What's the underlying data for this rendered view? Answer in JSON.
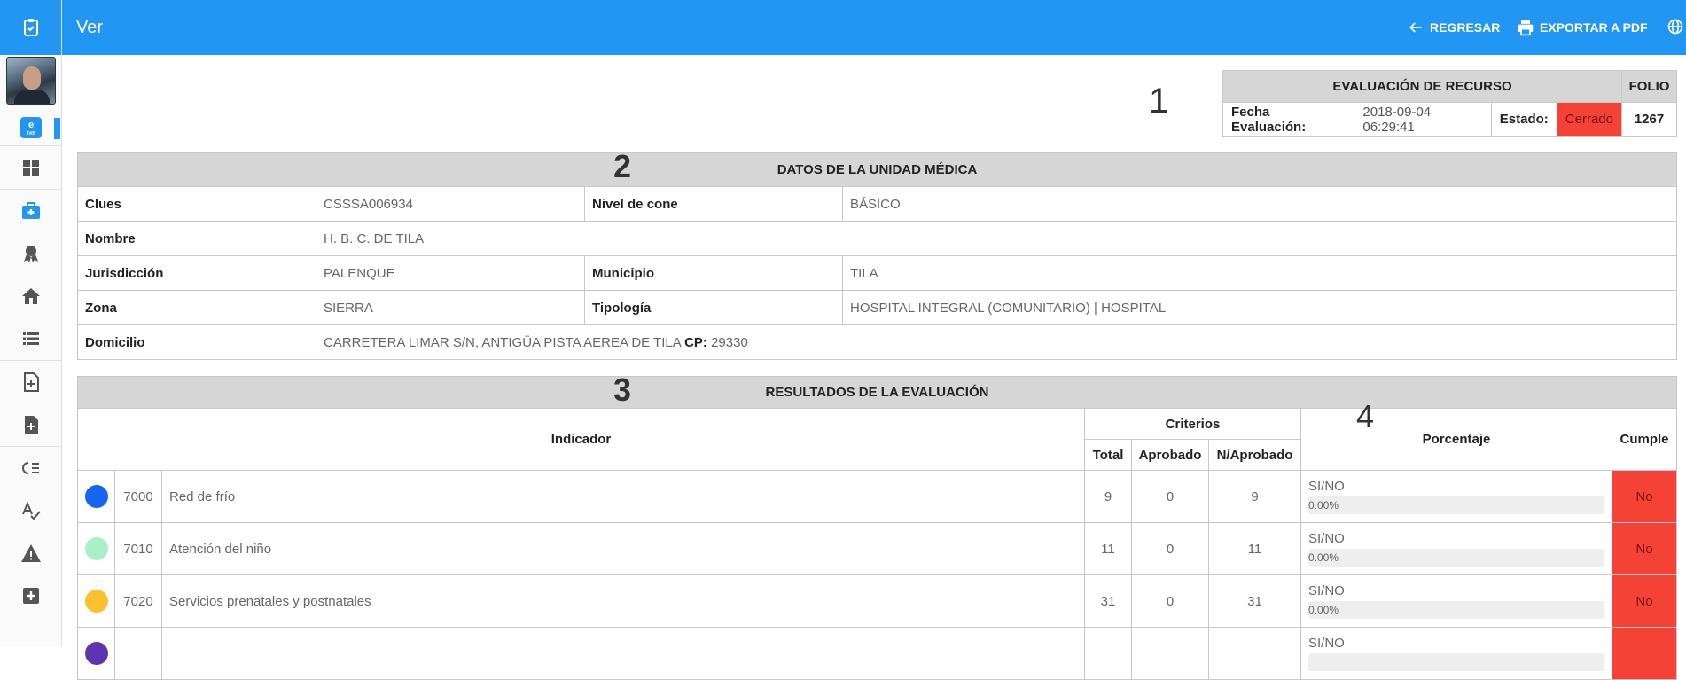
{
  "app": {
    "logo_icon": "clipboard-icon",
    "accent": "#2196f3"
  },
  "topbar": {
    "title": "Ver",
    "back_label": "REGRESAR",
    "export_label": "EXPORTAR A PDF"
  },
  "sidebar": {
    "items": [
      {
        "name": "dashboard-icon"
      },
      {
        "name": "medical-kit-icon"
      },
      {
        "name": "award-icon"
      },
      {
        "name": "house-icon"
      },
      {
        "name": "list-icon"
      },
      {
        "name": "add-document-icon"
      },
      {
        "name": "add-file-icon"
      },
      {
        "name": "checklist-icon"
      },
      {
        "name": "spellcheck-icon"
      },
      {
        "name": "warning-icon"
      },
      {
        "name": "plus-box-icon"
      }
    ],
    "etab": "e"
  },
  "markers": {
    "m1": "1",
    "m2": "2",
    "m3": "3",
    "m4": "4"
  },
  "evaluation": {
    "header": "EVALUACIÓN DE RECURSO",
    "folio_header": "FOLIO",
    "fecha_label": "Fecha Evaluación:",
    "fecha_value": "2018-09-04 06:29:41",
    "estado_label": "Estado:",
    "estado_value": "Cerrado",
    "folio_value": "1267"
  },
  "unit": {
    "header": "DATOS DE LA UNIDAD MÉDICA",
    "clues_label": "Clues",
    "clues_value": "CSSSA006934",
    "nivel_label": "Nivel de cone",
    "nivel_value": "BÁSICO",
    "nombre_label": "Nombre",
    "nombre_value": "H. B. C. DE TILA",
    "jurisdiccion_label": "Jurisdicción",
    "jurisdiccion_value": "PALENQUE",
    "municipio_label": "Municipio",
    "municipio_value": "TILA",
    "zona_label": "Zona",
    "zona_value": "SIERRA",
    "tipologia_label": "Tipología",
    "tipologia_value": "HOSPITAL INTEGRAL (COMUNITARIO) | HOSPITAL",
    "domicilio_label": "Domicilio",
    "domicilio_value": "CARRETERA LIMAR S/N, ANTIGÜA PISTA AEREA DE TILA",
    "cp_label": "CP:",
    "cp_value": "29330"
  },
  "results": {
    "header": "RESULTADOS DE LA EVALUACIÓN",
    "col_indicador": "Indicador",
    "col_criterios": "Criterios",
    "col_total": "Total",
    "col_aprobado": "Aprobado",
    "col_naprobado": "N/Aprobado",
    "col_porcentaje": "Porcentaje",
    "col_cumple": "Cumple",
    "rows": [
      {
        "color": "#1565f0",
        "code": "7000",
        "name": "Red de frío",
        "total": "9",
        "aprobado": "0",
        "naprobado": "9",
        "sino": "SI/NO",
        "pct": "0.00%",
        "pct_value": 0,
        "cumple": "No"
      },
      {
        "color": "#a8f0c8",
        "code": "7010",
        "name": "Atención del niño",
        "total": "11",
        "aprobado": "0",
        "naprobado": "11",
        "sino": "SI/NO",
        "pct": "0.00%",
        "pct_value": 0,
        "cumple": "No"
      },
      {
        "color": "#fbc02d",
        "code": "7020",
        "name": "Servicios prenatales y postnatales",
        "total": "31",
        "aprobado": "0",
        "naprobado": "31",
        "sino": "SI/NO",
        "pct": "0.00%",
        "pct_value": 0,
        "cumple": "No"
      },
      {
        "color": "#5e35b1",
        "code": "",
        "name": "",
        "total": "",
        "aprobado": "",
        "naprobado": "",
        "sino": "SI/NO",
        "pct": "",
        "pct_value": 0,
        "cumple": ""
      }
    ]
  }
}
